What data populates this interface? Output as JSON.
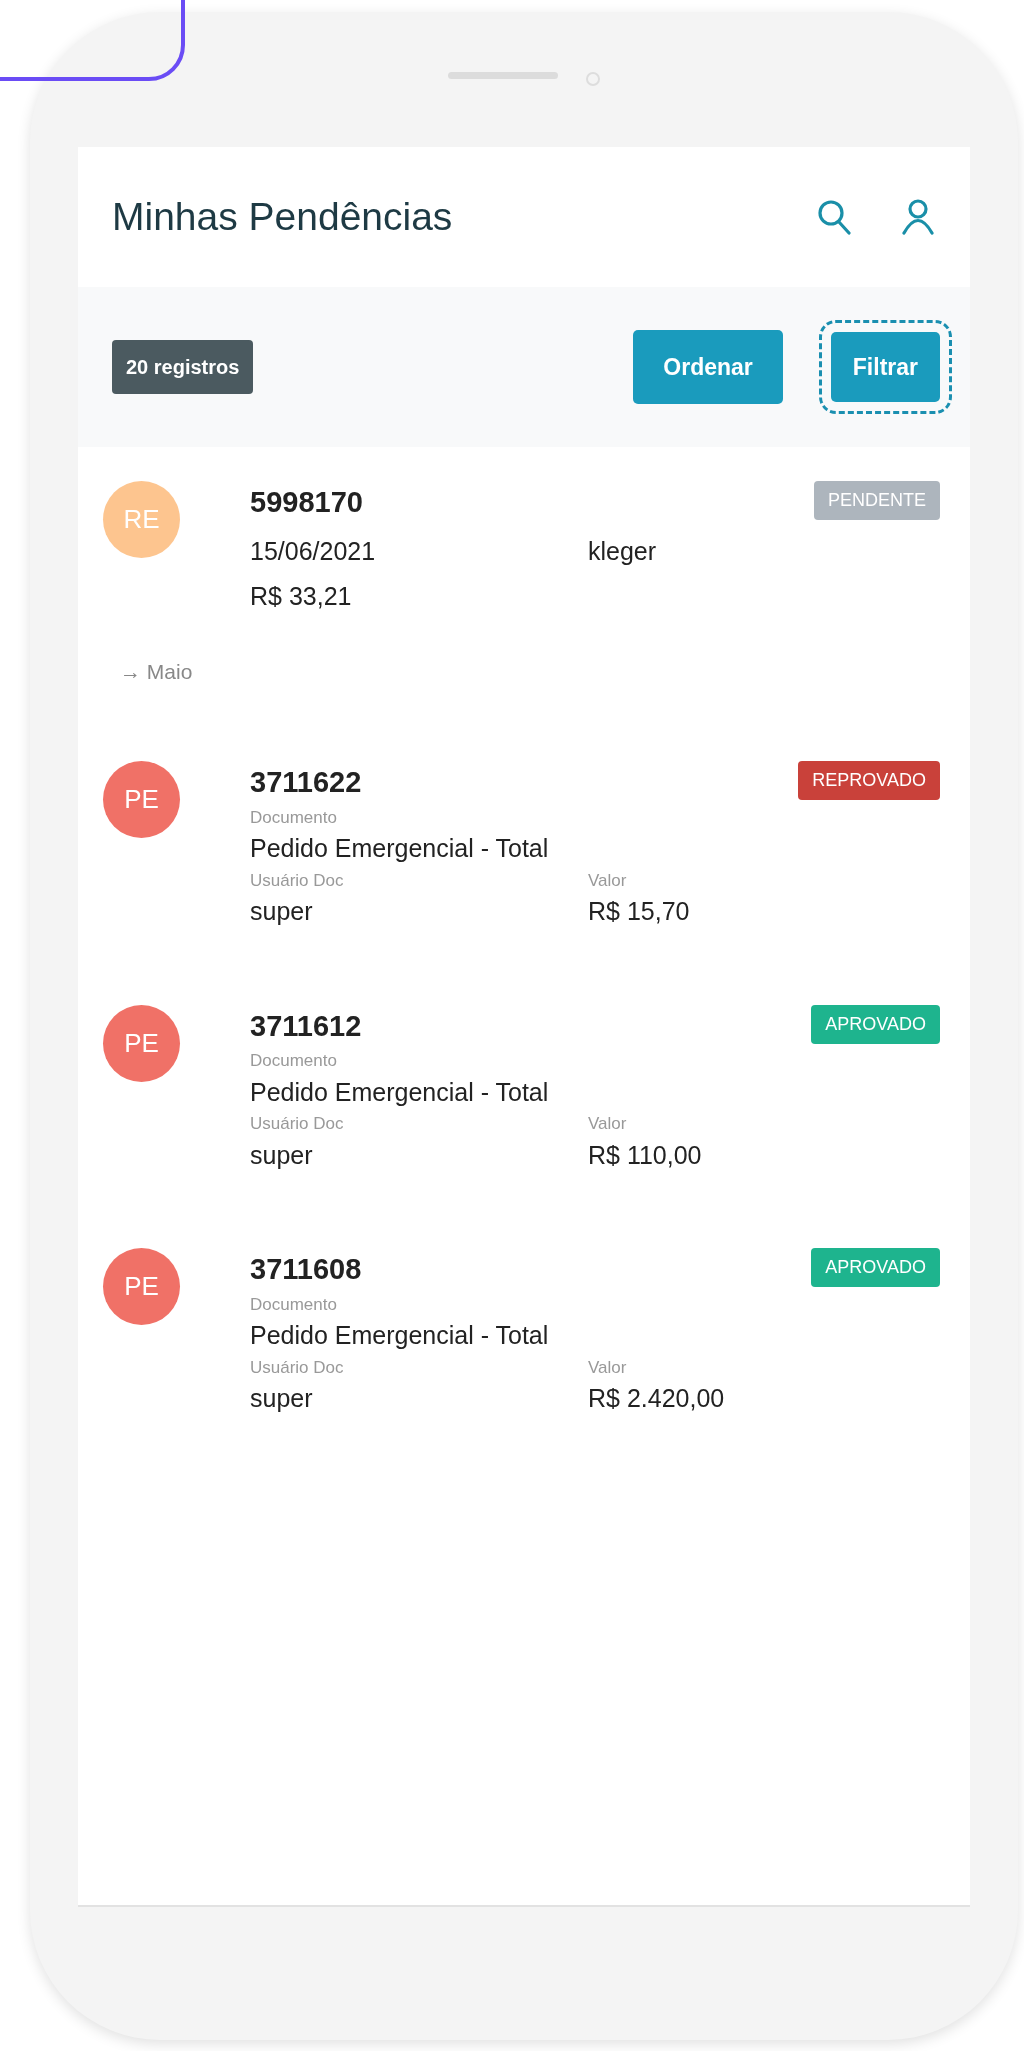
{
  "header": {
    "title": "Minhas Pendências"
  },
  "toolbar": {
    "count_badge": "20 registros",
    "buttons": [
      {
        "label": "Ordenar",
        "focused": false
      },
      {
        "label": "Filtrar",
        "focused": true
      }
    ]
  },
  "sections": [
    {
      "items": [
        {
          "kind": "summary",
          "avatar": {
            "initials": "RE",
            "color": "#fdc58f"
          },
          "number": "5998170",
          "status": "PENDENTE",
          "color": "#adb5bd",
          "date": "15/06/2021",
          "user": "kleger",
          "value": "R$ 33,21"
        }
      ]
    },
    {
      "heading": "→ Maio",
      "items": [
        {
          "kind": "detailed",
          "avatar": {
            "initials": "PE",
            "color": "#f07167"
          },
          "number": "3711622",
          "status": "REPROVADO",
          "color": "#c9413a",
          "document_label": "Documento",
          "document": "Pedido Emergencial - Total",
          "user_label": "Usuário Doc",
          "user": "super",
          "value_label": "Valor",
          "value": "R$ 15,70"
        },
        {
          "kind": "detailed",
          "avatar": {
            "initials": "PE",
            "color": "#f07167"
          },
          "number": "3711612",
          "status": "APROVADO",
          "color": "#1eb48e",
          "document_label": "Documento",
          "document": "Pedido Emergencial - Total",
          "user_label": "Usuário Doc",
          "user": "super",
          "value_label": "Valor",
          "value": "R$ 110,00"
        },
        {
          "kind": "detailed",
          "avatar": {
            "initials": "PE",
            "color": "#f07167"
          },
          "number": "3711608",
          "status": "APROVADO",
          "color": "#1eb48e",
          "document_label": "Documento",
          "document": "Pedido Emergencial - Total",
          "user_label": "Usuário Doc",
          "user": "super",
          "value_label": "Valor",
          "value": "R$ 2.420,00"
        }
      ]
    }
  ]
}
